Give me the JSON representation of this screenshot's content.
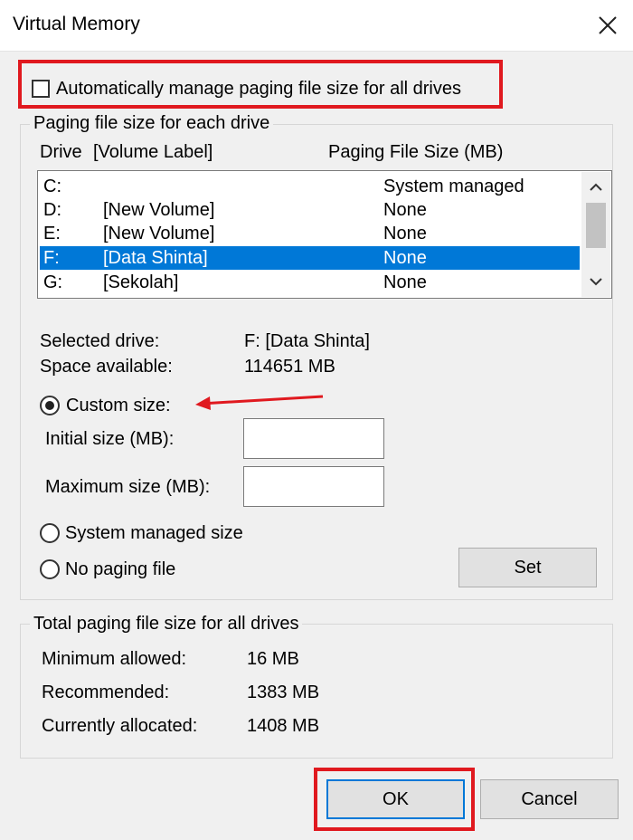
{
  "window": {
    "title": "Virtual Memory"
  },
  "auto_manage": {
    "label": "Automatically manage paging file size for all drives",
    "checked": false
  },
  "paging_group": {
    "title": "Paging file size for each drive",
    "col_drive": "Drive",
    "col_volume": "[Volume Label]",
    "col_size": "Paging File Size (MB)",
    "rows": [
      {
        "drive": "C:",
        "volume": "",
        "size": "System managed",
        "selected": false
      },
      {
        "drive": "D:",
        "volume": "[New Volume]",
        "size": "None",
        "selected": false
      },
      {
        "drive": "E:",
        "volume": "[New Volume]",
        "size": "None",
        "selected": false
      },
      {
        "drive": "F:",
        "volume": "[Data Shinta]",
        "size": "None",
        "selected": true
      },
      {
        "drive": "G:",
        "volume": "[Sekolah]",
        "size": "None",
        "selected": false
      }
    ],
    "selected_drive_label": "Selected drive:",
    "selected_drive_value": "F:  [Data Shinta]",
    "space_label": "Space available:",
    "space_value": "114651 MB",
    "custom_size_label": "Custom size:",
    "initial_size_label": "Initial size (MB):",
    "initial_size_value": "",
    "maximum_size_label": "Maximum size (MB):",
    "maximum_size_value": "",
    "system_managed_label": "System managed size",
    "no_paging_label": "No paging file",
    "set_button": "Set",
    "selected_option": "custom"
  },
  "total_group": {
    "title": "Total paging file size for all drives",
    "minimum_label": "Minimum allowed:",
    "minimum_value": "16 MB",
    "recommended_label": "Recommended:",
    "recommended_value": "1383 MB",
    "allocated_label": "Currently allocated:",
    "allocated_value": "1408 MB"
  },
  "buttons": {
    "ok": "OK",
    "cancel": "Cancel"
  },
  "colors": {
    "annotation_red": "#e0191f",
    "selection_blue": "#0078d7"
  }
}
